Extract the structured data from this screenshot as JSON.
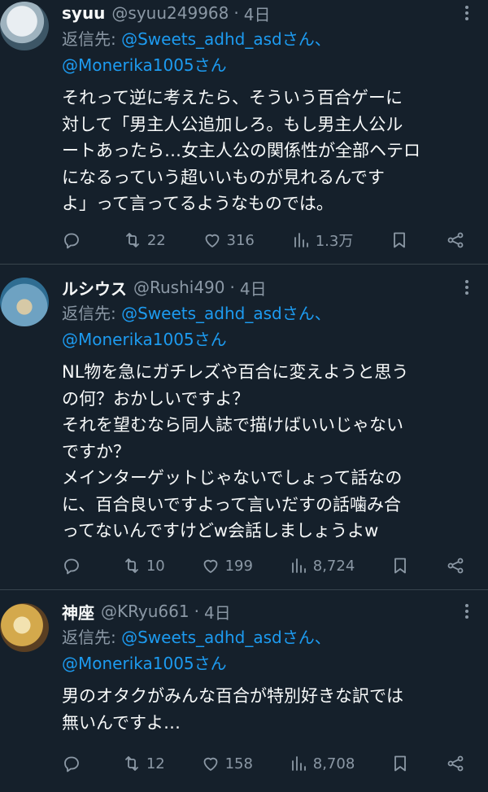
{
  "reply_prefix": "返信先: ",
  "tweets": [
    {
      "name": "syuu",
      "handle": "@syuu249968",
      "time": "4日",
      "reply_to_1": "@Sweets_adhd_asdさん、",
      "reply_to_2": "@Monerika1005さん",
      "text": "それって逆に考えたら、そういう百合ゲーに\n対して「男主人公追加しろ。もし男主人公ル\nートあったら…女主人公の関係性が全部ヘテロ\nになるっていう超いいものが見れるんです\nよ」って言ってるようなものでは。",
      "replies": "",
      "retweets": "22",
      "likes": "316",
      "views": "1.3万"
    },
    {
      "name": "ルシウス",
      "handle": "@Rushi490",
      "time": "4日",
      "reply_to_1": "@Sweets_adhd_asdさん、",
      "reply_to_2": "@Monerika1005さん",
      "text": "NL物を急にガチレズや百合に変えようと思う\nの何？おかしいですよ？\nそれを望むなら同人誌で描けばいいじゃない\nですか？\nメインターゲットじゃないでしょって話なの\nに、百合良いですよって言いだすの話噛み合\nってないんですけどw会話しましょうよw",
      "replies": "",
      "retweets": "10",
      "likes": "199",
      "views": "8,724"
    },
    {
      "name": "神座",
      "handle": "@KRyu661",
      "time": "4日",
      "reply_to_1": "@Sweets_adhd_asdさん、",
      "reply_to_2": "@Monerika1005さん",
      "text": "男のオタクがみんな百合が特別好きな訳では\n無いんですよ…",
      "replies": "",
      "retweets": "12",
      "likes": "158",
      "views": "8,708"
    }
  ],
  "colors": {
    "background": "#15202b",
    "text": "#f7f9f9",
    "secondary": "#8b98a5",
    "link": "#1d9bf0",
    "divider": "#38444d"
  },
  "icons": [
    "reply-icon",
    "retweet-icon",
    "like-icon",
    "views-icon",
    "bookmark-icon",
    "share-icon",
    "more-icon"
  ]
}
